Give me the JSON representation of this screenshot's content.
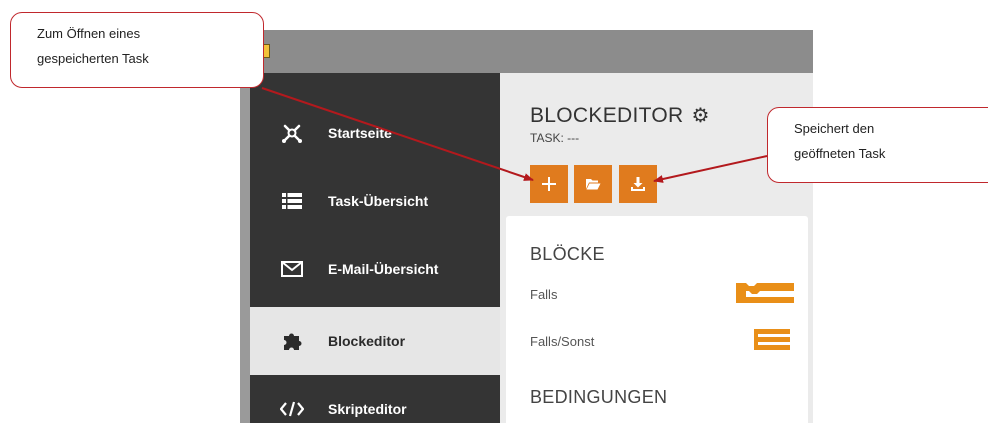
{
  "callouts": {
    "open": {
      "line1": "Zum Öffnen eines",
      "line2": "gespeicherten Task"
    },
    "save": {
      "line1": "Speichert den",
      "line2": "geöffneten Task"
    }
  },
  "sidebar": {
    "items": [
      {
        "label": "Startseite",
        "icon": "network-icon"
      },
      {
        "label": "Task-Übersicht",
        "icon": "list-icon"
      },
      {
        "label": "E-Mail-Übersicht",
        "icon": "envelope-icon"
      },
      {
        "label": "Blockeditor",
        "icon": "puzzle-icon",
        "active": true
      },
      {
        "label": "Skripteditor",
        "icon": "code-icon"
      }
    ]
  },
  "main": {
    "title": "BLOCKEDITOR",
    "task_label": "TASK: ---",
    "buttons": [
      "new",
      "open",
      "save"
    ],
    "sections": [
      {
        "heading": "BLÖCKE",
        "blocks": [
          "Falls",
          "Falls/Sonst"
        ]
      },
      {
        "heading": "BEDINGUNGEN"
      }
    ]
  },
  "colors": {
    "accent": "#e07b1e",
    "sidebar": "#343434",
    "callout_border": "#c0282d"
  }
}
